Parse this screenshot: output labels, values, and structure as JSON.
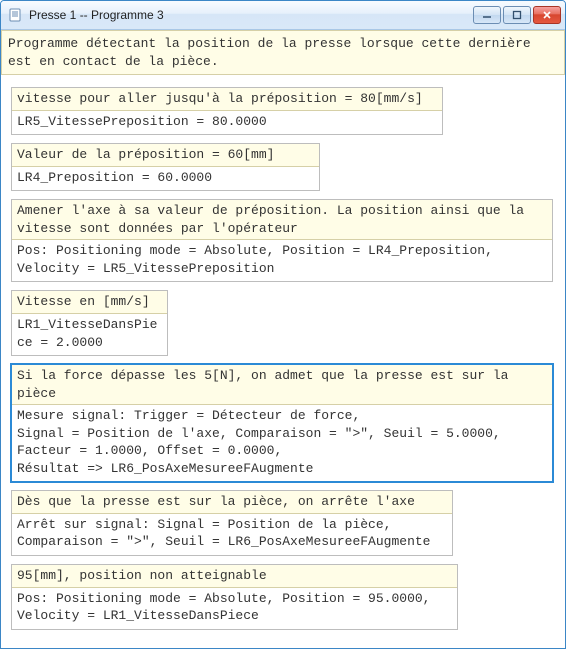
{
  "window": {
    "title": "Presse 1 -- Programme 3"
  },
  "header_comment": "Programme détectant la position de la presse lorsque cette dernière est en contact de la pièce.",
  "blocks": [
    {
      "label": "vitesse pour aller jusqu'à la préposition = 80[mm/s]",
      "code": "LR5_VitessePreposition = 80.0000"
    },
    {
      "label": "Valeur de la préposition = 60[mm]",
      "code": "LR4_Preposition = 60.0000"
    },
    {
      "label": "Amener l'axe à sa valeur de préposition.\nLa position ainsi que la vitesse sont données par l'opérateur",
      "code": "Pos: Positioning mode = Absolute, Position = LR4_Preposition, Velocity = LR5_VitessePreposition"
    },
    {
      "label": "Vitesse en [mm/s]",
      "code": "LR1_VitesseDansPiece = 2.0000"
    },
    {
      "label": "Si la force dépasse les 5[N], on admet que la presse est sur la pièce",
      "code": "Mesure signal: Trigger = Détecteur de force,\nSignal = Position de l'axe, Comparaison = \">\", Seuil = 5.0000, Facteur = 1.0000, Offset = 0.0000,\nRésultat => LR6_PosAxeMesureeFAugmente"
    },
    {
      "label": "Dès que la presse est sur la pièce, on arrête l'axe",
      "code": "Arrêt sur signal: Signal = Position de la pièce, Comparaison = \">\", Seuil = LR6_PosAxeMesureeFAugmente"
    },
    {
      "label": "95[mm], position non atteignable",
      "code": "Pos: Positioning mode = Absolute, Position = 95.0000, Velocity = LR1_VitesseDansPiece"
    }
  ]
}
